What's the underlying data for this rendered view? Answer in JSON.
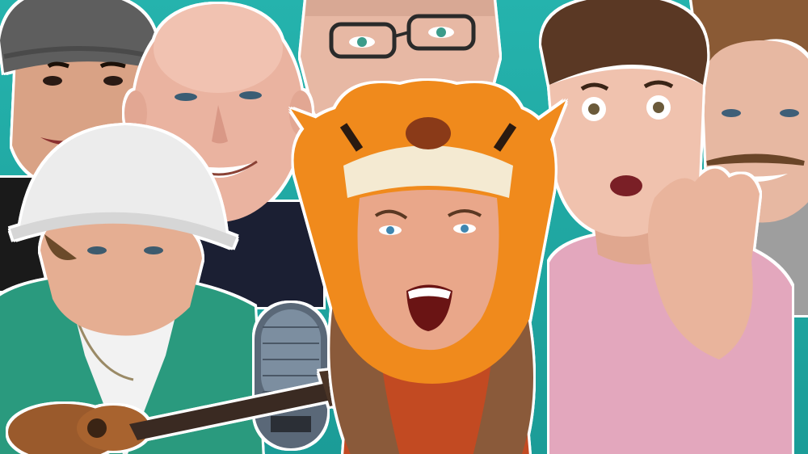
{
  "image": {
    "width": 1000,
    "height": 562,
    "background_color": "#1fa6a2",
    "outline_color": "#ffffff"
  },
  "people": [
    {
      "name": "person-beanie-top-left"
    },
    {
      "name": "person-bald-smiling"
    },
    {
      "name": "person-glasses-top-center"
    },
    {
      "name": "person-wide-eyes-right"
    },
    {
      "name": "person-mustache-far-right"
    },
    {
      "name": "person-bucket-hat-guitar"
    },
    {
      "name": "person-tiger-hood-center"
    }
  ],
  "objects": [
    {
      "name": "microphone"
    },
    {
      "name": "ukulele"
    }
  ]
}
